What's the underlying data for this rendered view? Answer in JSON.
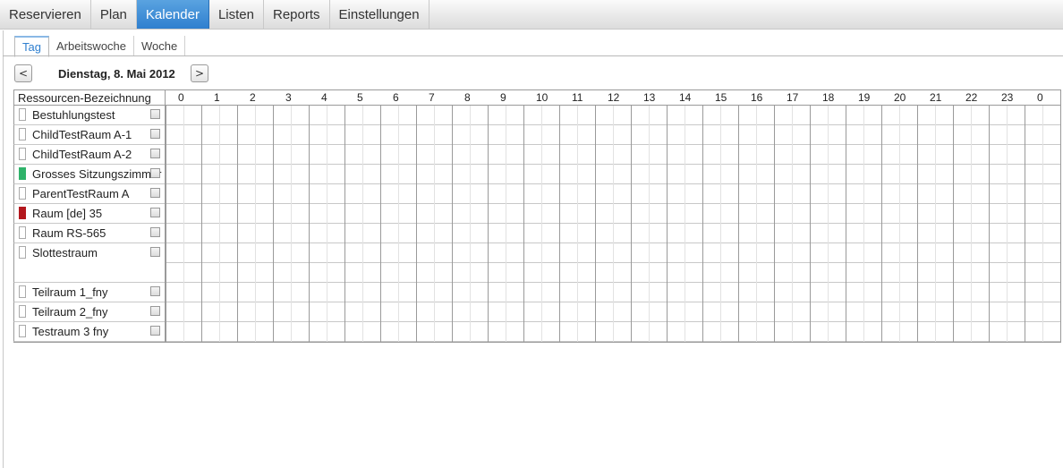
{
  "menu": {
    "items": [
      {
        "label": "Reservieren",
        "active": false
      },
      {
        "label": "Plan",
        "active": false
      },
      {
        "label": "Kalender",
        "active": true
      },
      {
        "label": "Listen",
        "active": false
      },
      {
        "label": "Reports",
        "active": false
      },
      {
        "label": "Einstellungen",
        "active": false
      }
    ]
  },
  "subtabs": [
    {
      "label": "Tag",
      "active": true
    },
    {
      "label": "Arbeitswoche",
      "active": false
    },
    {
      "label": "Woche",
      "active": false
    }
  ],
  "date_nav": {
    "prev_label": "<",
    "next_label": ">",
    "date": "Dienstag, 8. Mai 2012"
  },
  "grid": {
    "resource_header": "Ressourcen-Bezeichnung",
    "hours": [
      "0",
      "1",
      "2",
      "3",
      "4",
      "5",
      "6",
      "7",
      "8",
      "9",
      "10",
      "11",
      "12",
      "13",
      "14",
      "15",
      "16",
      "17",
      "18",
      "19",
      "20",
      "21",
      "22",
      "23",
      "0"
    ],
    "resources": [
      {
        "name": "Bestuhlungstest",
        "color": "#ffffff",
        "lines": 1
      },
      {
        "name": "ChildTestRaum A-1",
        "color": "#ffffff",
        "lines": 1
      },
      {
        "name": "ChildTestRaum A-2",
        "color": "#ffffff",
        "lines": 1
      },
      {
        "name": "Grosses Sitzungszimmer",
        "color": "#2fb36a",
        "lines": 1
      },
      {
        "name": "ParentTestRaum A",
        "color": "#ffffff",
        "lines": 1
      },
      {
        "name": "Raum [de] 35",
        "color": "#b3171d",
        "lines": 1
      },
      {
        "name": "Raum RS-565",
        "color": "#ffffff",
        "lines": 1
      },
      {
        "name": "Slottestraum",
        "color": "#ffffff",
        "lines": 2
      },
      {
        "name": "Teilraum 1_fny",
        "color": "#ffffff",
        "lines": 1
      },
      {
        "name": "Teilraum 2_fny",
        "color": "#ffffff",
        "lines": 1
      },
      {
        "name": "Testraum 3 fny",
        "color": "#ffffff",
        "lines": 1
      }
    ]
  }
}
